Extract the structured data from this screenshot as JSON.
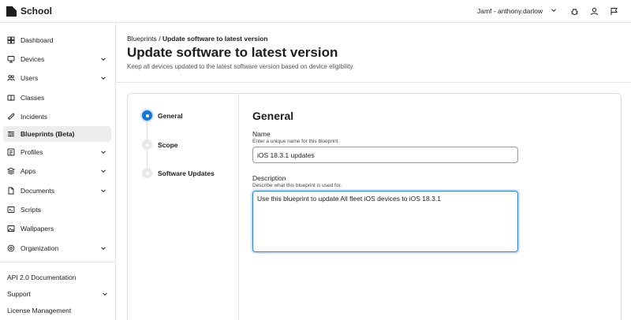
{
  "app": {
    "name": "School"
  },
  "account": {
    "label": "Jamf - anthony.darlow"
  },
  "top_icons": [
    "bug-icon",
    "user-icon",
    "flag-icon"
  ],
  "sidebar": {
    "items": [
      {
        "label": "Dashboard",
        "icon": "dashboard-icon",
        "has_chevron": false,
        "active": false
      },
      {
        "label": "Devices",
        "icon": "devices-icon",
        "has_chevron": true,
        "active": false
      },
      {
        "label": "Users",
        "icon": "users-icon",
        "has_chevron": true,
        "active": false
      },
      {
        "label": "Classes",
        "icon": "classes-icon",
        "has_chevron": false,
        "active": false
      },
      {
        "label": "Incidents",
        "icon": "incidents-icon",
        "has_chevron": false,
        "active": false
      },
      {
        "label": "Blueprints (Beta)",
        "icon": "blueprints-icon",
        "has_chevron": false,
        "active": true
      },
      {
        "label": "Profiles",
        "icon": "profiles-icon",
        "has_chevron": true,
        "active": false
      },
      {
        "label": "Apps",
        "icon": "apps-icon",
        "has_chevron": true,
        "active": false
      },
      {
        "label": "Documents",
        "icon": "documents-icon",
        "has_chevron": true,
        "active": false
      },
      {
        "label": "Scripts",
        "icon": "scripts-icon",
        "has_chevron": false,
        "active": false
      },
      {
        "label": "Wallpapers",
        "icon": "wallpapers-icon",
        "has_chevron": false,
        "active": false
      },
      {
        "label": "Organization",
        "icon": "organization-icon",
        "has_chevron": true,
        "active": false
      }
    ],
    "footer_links": [
      {
        "label": "API 2.0 Documentation",
        "has_chevron": false
      },
      {
        "label": "Support",
        "has_chevron": true
      },
      {
        "label": "License Management",
        "has_chevron": false
      }
    ]
  },
  "breadcrumb": {
    "parent": "Blueprints",
    "separator": "/",
    "current": "Update software to latest version"
  },
  "page": {
    "title": "Update software to latest version",
    "subtitle": "Keep all devices updated to the latest software version based on device eligibility."
  },
  "steps": [
    {
      "label": "General",
      "active": true
    },
    {
      "label": "Scope",
      "active": false
    },
    {
      "label": "Software Updates",
      "active": false
    }
  ],
  "form": {
    "title": "General",
    "name": {
      "label": "Name",
      "help": "Enter a unique name for this blueprint.",
      "value": "iOS 18.3.1 updates"
    },
    "description": {
      "label": "Description",
      "help": "Describe what this blueprint is used for.",
      "value": "Use this blueprint to update All fleet iOS devices to iOS 18.3.1"
    }
  },
  "colors": {
    "accent": "#1a73d9",
    "active_nav_bg": "#ededef",
    "text": "#1d1d1f"
  }
}
